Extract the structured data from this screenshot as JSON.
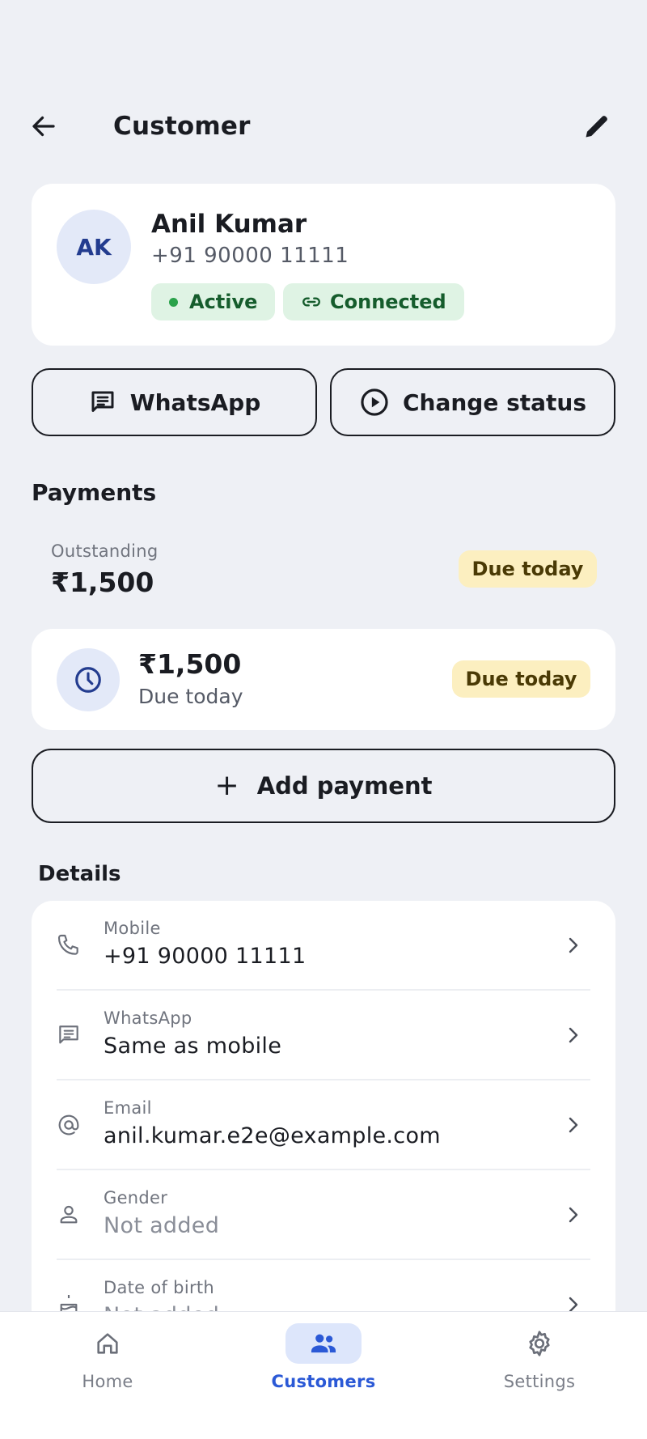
{
  "header": {
    "title": "Customer",
    "back_icon": "arrow-left-icon",
    "edit_icon": "pencil-icon"
  },
  "customer": {
    "initials": "AK",
    "name": "Anil Kumar",
    "phone": "+91 90000 11111",
    "chips": {
      "active": "Active",
      "connected": "Connected"
    }
  },
  "actions": {
    "whatsapp": "WhatsApp",
    "change_status": "Change status"
  },
  "payments": {
    "title": "Payments",
    "outstanding_label": "Outstanding",
    "outstanding_amount": "₹1,500",
    "outstanding_badge": "Due today",
    "item": {
      "amount": "₹1,500",
      "subtitle": "Due today",
      "badge": "Due today"
    },
    "add_button": "Add payment",
    "add_icon": "+"
  },
  "details": {
    "title": "Details",
    "rows": [
      {
        "label": "Mobile",
        "value": "+91 90000 11111",
        "icon": "phone-icon"
      },
      {
        "label": "WhatsApp",
        "value": "Same as mobile",
        "icon": "message-icon"
      },
      {
        "label": "Email",
        "value": "anil.kumar.e2e@example.com",
        "icon": "at-icon"
      },
      {
        "label": "Gender",
        "value": "Not added",
        "icon": "person-icon"
      },
      {
        "label": "Date of birth",
        "value": "Not added",
        "icon": "cake-icon"
      }
    ]
  },
  "nav": {
    "home": "Home",
    "customers": "Customers",
    "settings": "Settings",
    "active": "Customers"
  },
  "colors": {
    "accent": "#2b59d6",
    "active_chip_bg": "#dff3e4",
    "due_badge_bg": "#fcefc0",
    "background": "#eef0f5"
  }
}
